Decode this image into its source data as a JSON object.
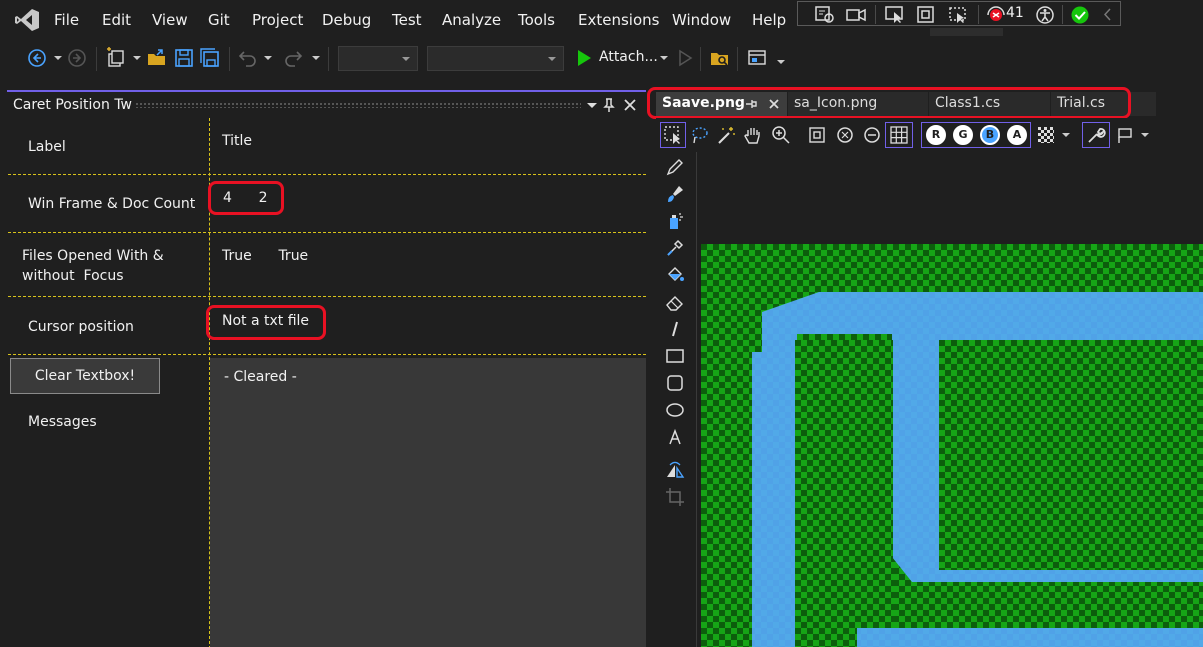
{
  "menu": {
    "items": [
      "File",
      "Edit",
      "View",
      "Git",
      "Project",
      "Debug",
      "Test",
      "Analyze",
      "Tools",
      "Extensions",
      "Window",
      "Help"
    ]
  },
  "status_strip": {
    "issue_count": "41",
    "icons": [
      "diagnostics-icon",
      "record-icon",
      "pointer-icon",
      "frame-icon",
      "region-select-icon",
      "bug-icon",
      "accessibility-icon",
      "check-icon",
      "collapse-icon"
    ]
  },
  "toolbar": {
    "attach_label": "Attach...",
    "config_combo": "",
    "platform_combo": ""
  },
  "tool_window": {
    "title": "Caret Position Tw",
    "rows": [
      {
        "label": "Label",
        "value": "Title"
      },
      {
        "label": "Win Frame & Doc Count",
        "value": "4      2"
      },
      {
        "label_line1": "Files Opened With &",
        "label_line2": "without  Focus",
        "value": "True      True"
      },
      {
        "label": "Cursor position",
        "value": "Not a txt file"
      }
    ],
    "clear_button": "Clear Textbox!",
    "messages_label": "Messages",
    "messages_text": "- Cleared -"
  },
  "doc_tabs": [
    {
      "label": "Saave.png",
      "active": true
    },
    {
      "label": "sa_Icon.png",
      "active": false
    },
    {
      "label": "Class1.cs",
      "active": false
    },
    {
      "label": "Trial.cs",
      "active": false
    }
  ],
  "image_editor": {
    "channel_buttons": [
      "R",
      "G",
      "B",
      "A"
    ]
  },
  "colors": {
    "accent": "#7160e8",
    "highlight": "#e81123",
    "grid_line": "#d8c21a",
    "image_green": "#16a516",
    "image_blue": "#58aaff"
  }
}
